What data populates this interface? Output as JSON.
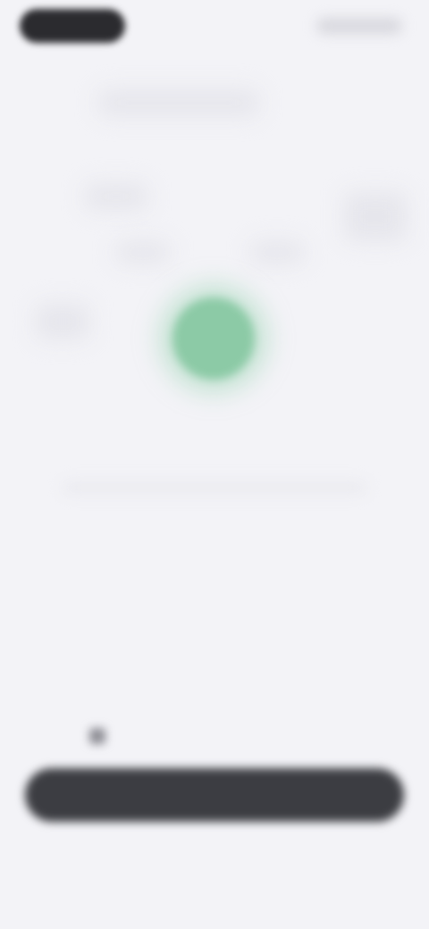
{
  "status_bar": {
    "pill_icon": "dynamic-island-pill",
    "right_icons": "status-icons"
  },
  "main": {
    "status_icon": "green-status-circle",
    "status_color": "#8ccaa6",
    "message_line1": "",
    "message_line2": "",
    "subtext": ""
  },
  "footer": {
    "hint_icon": "info-icon",
    "hint_text": "",
    "primary_button_label": "",
    "primary_button_color": "#3c3d42",
    "bottom_text": ""
  }
}
